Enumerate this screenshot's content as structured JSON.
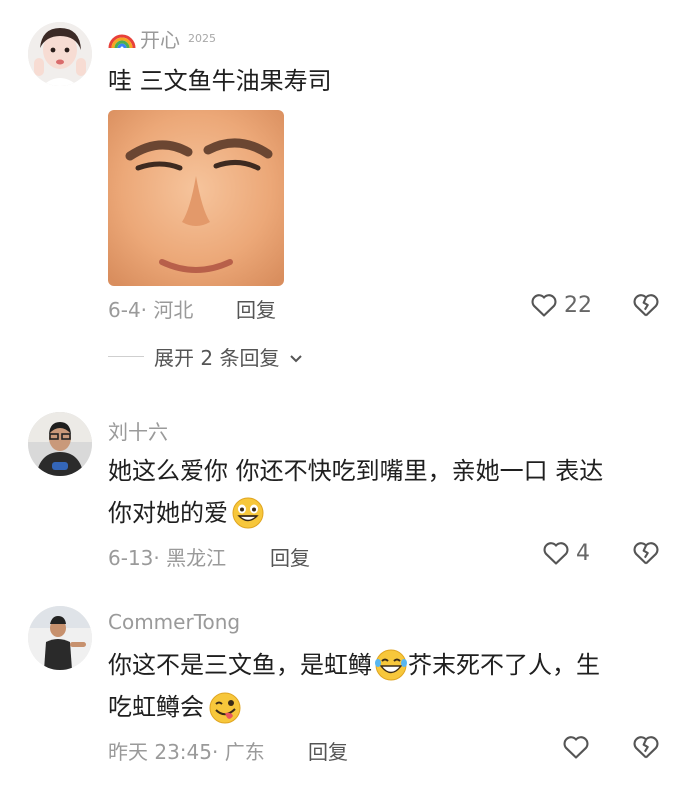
{
  "comments": [
    {
      "username": "开心",
      "badge_year": "2025",
      "text": "哇 三文鱼牛油果寿司",
      "date": "6-4",
      "location": "河北",
      "reply_label": "回复",
      "likes": "22",
      "expand_label": "展开 2 条回复"
    },
    {
      "username": "刘十六",
      "text_line1": "她这么爱你 你还不快吃到嘴里，亲她一口 表达",
      "text_line2": "你对她的爱",
      "date": "6-13",
      "location": "黑龙江",
      "reply_label": "回复",
      "likes": "4"
    },
    {
      "username": "CommerTong",
      "text_line1": "你这不是三文鱼，是虹鳟",
      "text_line1b": "芥末死不了人，生",
      "text_line2": "吃虹鳟会",
      "date": "昨天 23:45",
      "location": "广东",
      "reply_label": "回复",
      "likes": ""
    }
  ],
  "icons": {
    "like": "heart-outline-icon",
    "dislike": "broken-heart-icon",
    "expand": "chevron-down-icon",
    "rainbow": "rainbow-icon"
  }
}
